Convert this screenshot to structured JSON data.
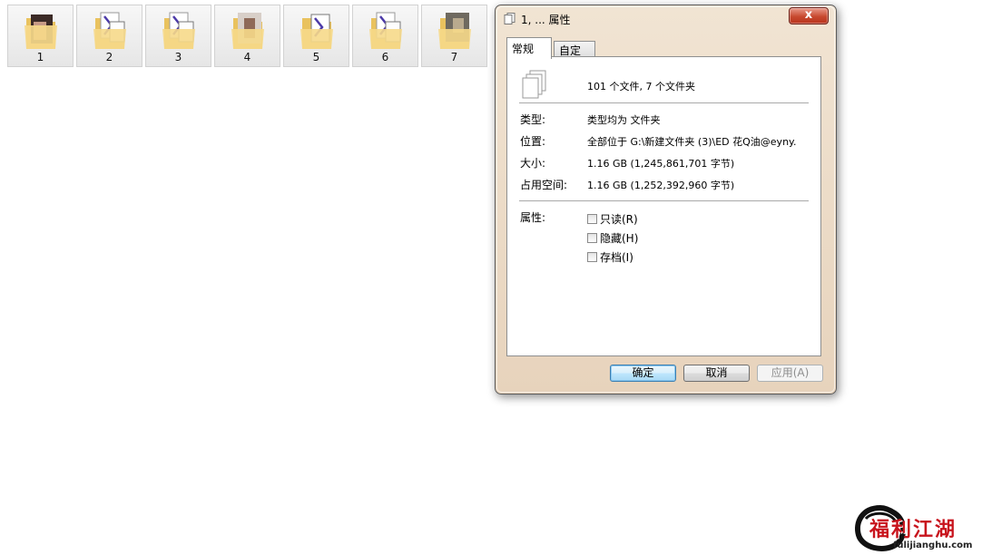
{
  "desktop": {
    "folders": [
      {
        "label": "1",
        "thumb": "photo"
      },
      {
        "label": "2",
        "thumb": "mp4"
      },
      {
        "label": "3",
        "thumb": "mp4"
      },
      {
        "label": "4",
        "thumb": "photo"
      },
      {
        "label": "5",
        "thumb": "mp4"
      },
      {
        "label": "6",
        "thumb": "mp4"
      },
      {
        "label": "7",
        "thumb": "photo"
      }
    ]
  },
  "dialog": {
    "title": "1, ... 属性",
    "close_label": "x",
    "tabs": [
      {
        "label": "常规",
        "active": true
      },
      {
        "label": "自定义",
        "active": false
      }
    ],
    "summary": "101 个文件, 7 个文件夹",
    "rows": [
      {
        "label": "类型:",
        "value": "类型均为 文件夹"
      },
      {
        "label": "位置:",
        "value": "全部位于 G:\\新建文件夹 (3)\\ED 花Q油@eyny."
      },
      {
        "label": "大小:",
        "value": "1.16 GB (1,245,861,701 字节)"
      },
      {
        "label": "占用空间:",
        "value": "1.16 GB (1,252,392,960 字节)"
      }
    ],
    "attributes_label": "属性:",
    "attributes": [
      {
        "label": "只读(R)",
        "checked": false
      },
      {
        "label": "隐藏(H)",
        "checked": false
      },
      {
        "label": "存档(I)",
        "checked": false
      }
    ],
    "buttons": {
      "ok": "确定",
      "cancel": "取消",
      "apply": "应用(A)"
    }
  },
  "watermark": {
    "title": "福利江湖",
    "url": "fulijianghu.com"
  },
  "colors": {
    "dialog_frame": "#e7d3bc",
    "close_button": "#c7492f",
    "ok_button_border": "#3c7fb1",
    "watermark_red": "#c8141d"
  }
}
